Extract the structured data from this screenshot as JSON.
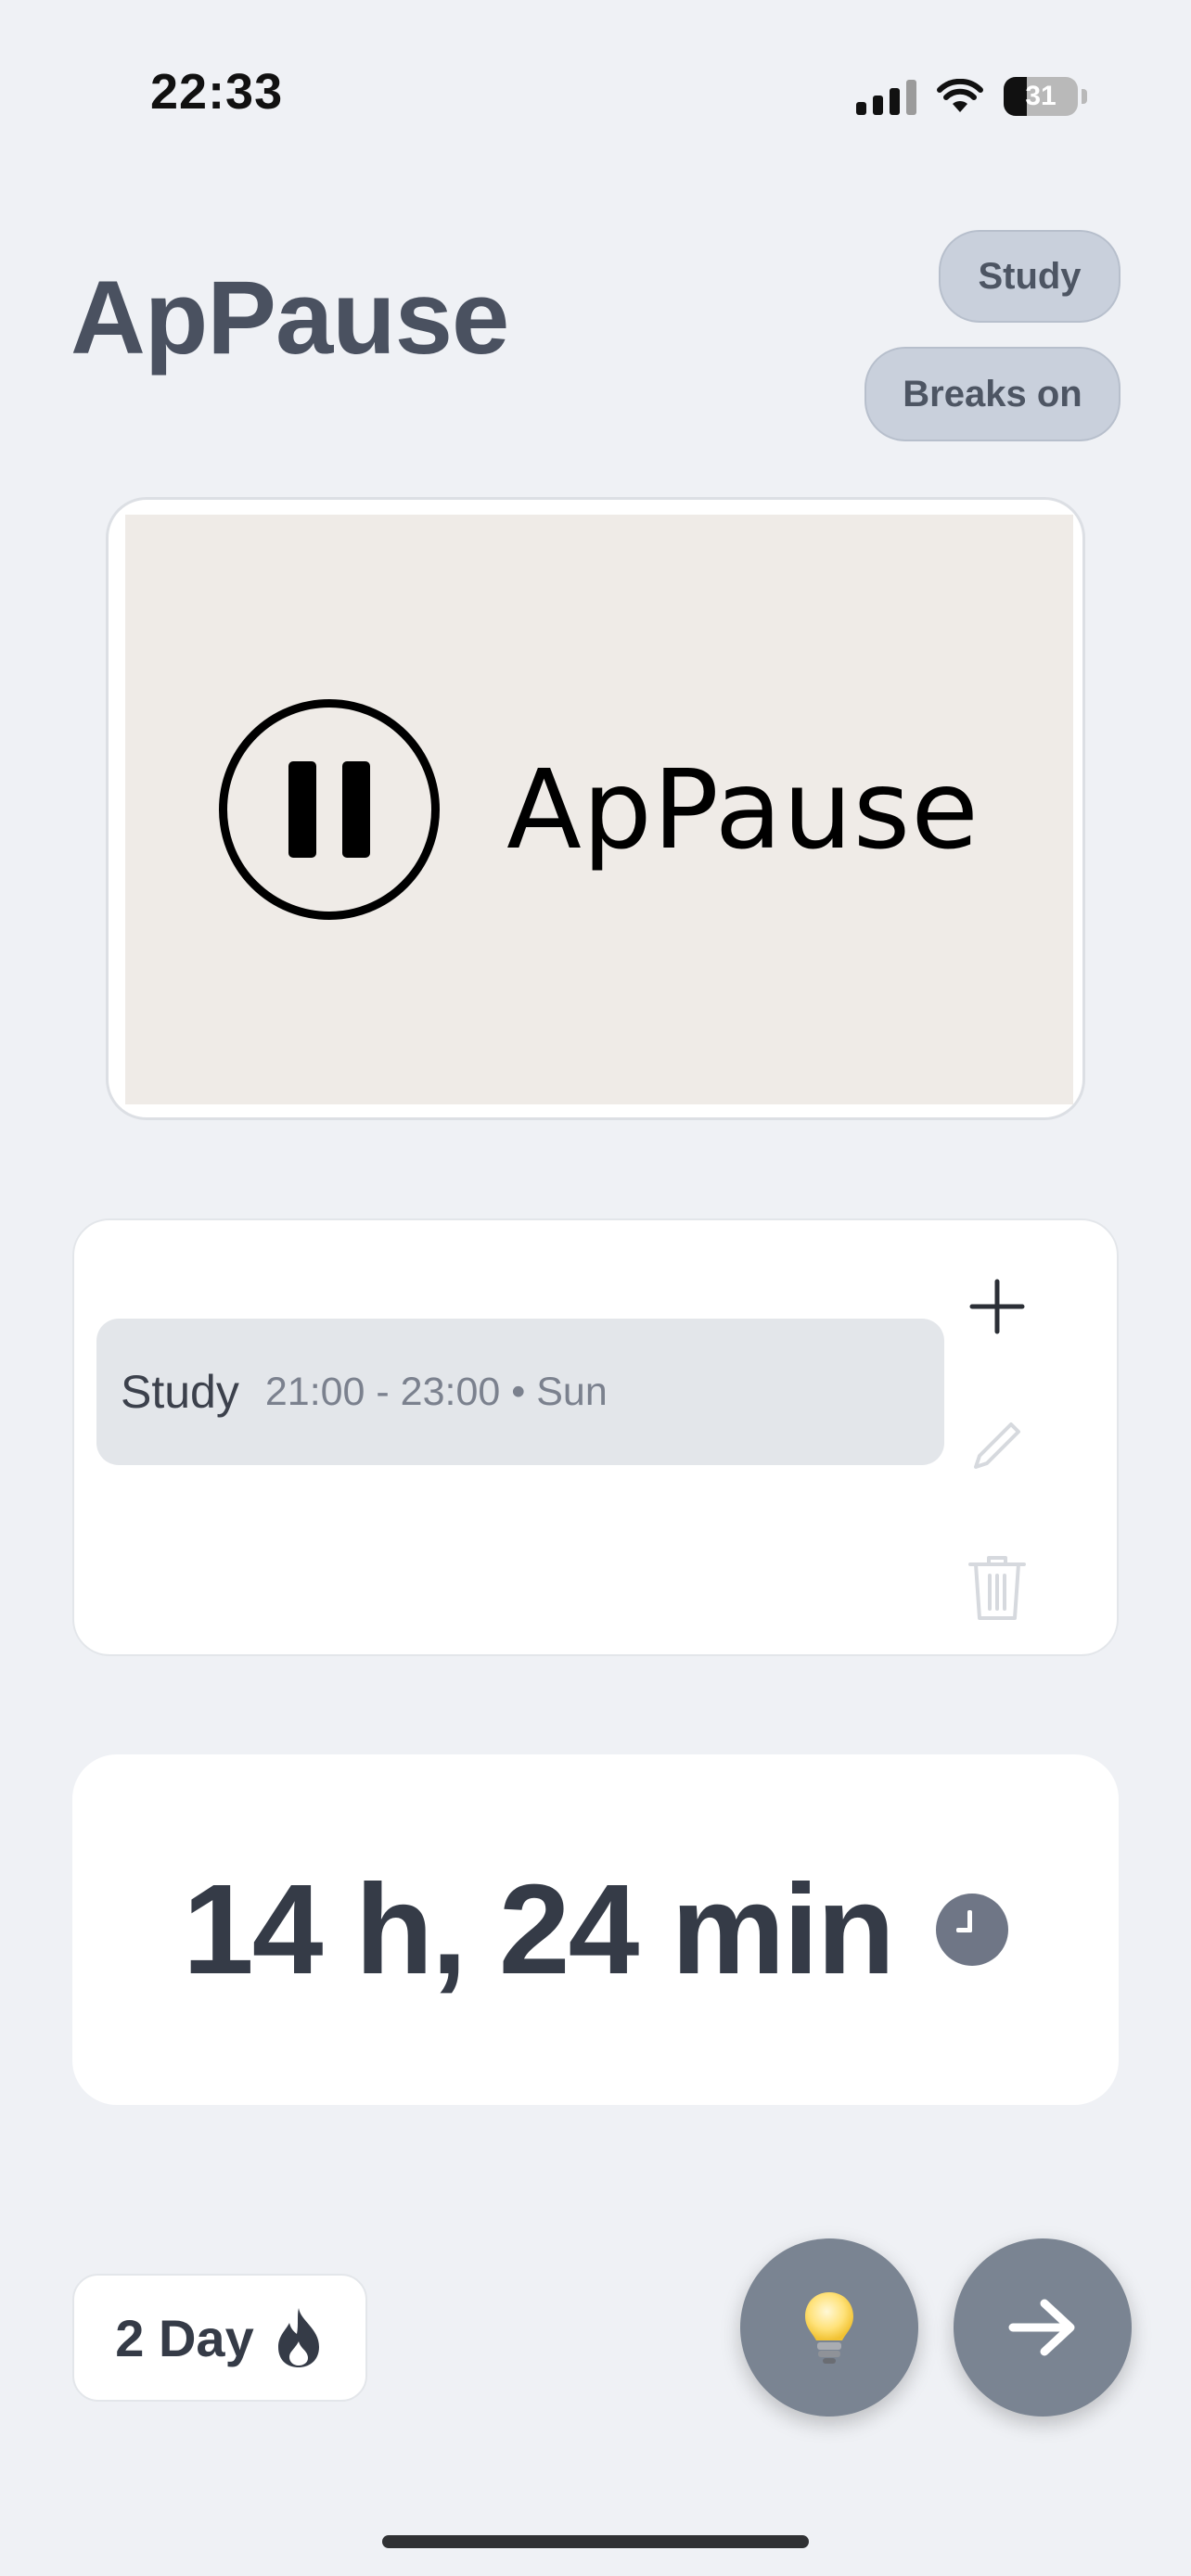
{
  "status_bar": {
    "time": "22:33",
    "battery_percent": "31"
  },
  "header": {
    "title": "ApPause",
    "mode_pill": "Study",
    "breaks_pill": "Breaks on"
  },
  "logo": {
    "wordmark": "ApPause",
    "icon": "pause-circle-icon"
  },
  "schedule": {
    "items": [
      {
        "name": "Study",
        "details": "21:00 - 23:00 • Sun"
      }
    ],
    "actions": [
      "plus-icon",
      "pencil-icon",
      "trash-icon"
    ]
  },
  "usage": {
    "time_text": "14 h, 24 min",
    "icon": "clock-icon"
  },
  "streak": {
    "label": "2 Day",
    "icon": "flame-icon"
  },
  "fabs": {
    "tips_icon": "lightbulb-icon",
    "next_icon": "arrow-right-icon"
  },
  "colors": {
    "background": "#eff1f5",
    "pill": "#c9d0dc",
    "fab": "#7a8492",
    "text_dark": "#353b47"
  }
}
